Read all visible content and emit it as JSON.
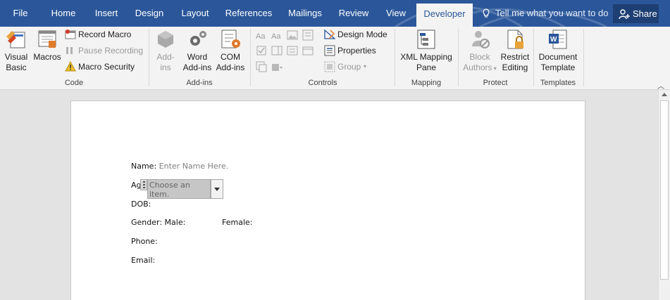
{
  "tabs": [
    {
      "label": "File",
      "active": false
    },
    {
      "label": "Home",
      "active": false
    },
    {
      "label": "Insert",
      "active": false
    },
    {
      "label": "Design",
      "active": false
    },
    {
      "label": "Layout",
      "active": false
    },
    {
      "label": "References",
      "active": false
    },
    {
      "label": "Mailings",
      "active": false
    },
    {
      "label": "Review",
      "active": false
    },
    {
      "label": "View",
      "active": false
    },
    {
      "label": "Developer",
      "active": true
    }
  ],
  "tell_me": "Tell me what you want to do",
  "share": "Share",
  "colors": {
    "ribbon_blue": "#2b579a",
    "share_bg": "#1e3f73",
    "ribbon_bg": "#f3f3f3",
    "field_gray": "#c6c6c6"
  },
  "ribbon": {
    "code": {
      "group_label": "Code",
      "visual_basic": [
        "Visual",
        "Basic"
      ],
      "macros": "Macros",
      "record_macro": "Record Macro",
      "pause_recording": "Pause Recording",
      "macro_security": "Macro Security"
    },
    "addins": {
      "group_label": "Add-ins",
      "addins": [
        "Add-",
        "ins"
      ],
      "word_addins": [
        "Word",
        "Add-ins"
      ],
      "com_addins": [
        "COM",
        "Add-ins"
      ]
    },
    "controls": {
      "group_label": "Controls",
      "design_mode": "Design Mode",
      "properties": "Properties",
      "group": "Group"
    },
    "mapping": {
      "group_label": "Mapping",
      "xml_mapping": [
        "XML Mapping",
        "Pane"
      ]
    },
    "protect": {
      "group_label": "Protect",
      "block_authors": [
        "Block",
        "Authors"
      ],
      "restrict_editing": [
        "Restrict",
        "Editing"
      ]
    },
    "templates": {
      "group_label": "Templates",
      "document_template": [
        "Document",
        "Template"
      ]
    }
  },
  "document": {
    "name_label": "Name:",
    "name_placeholder": "Enter Name Here.",
    "age_label": "Ag",
    "age_dropdown": "Choose an item.",
    "dob_label": "DOB:",
    "gender_label": "Gender: Male:",
    "female_label": "Female:",
    "phone_label": "Phone:",
    "email_label": "Email:"
  }
}
